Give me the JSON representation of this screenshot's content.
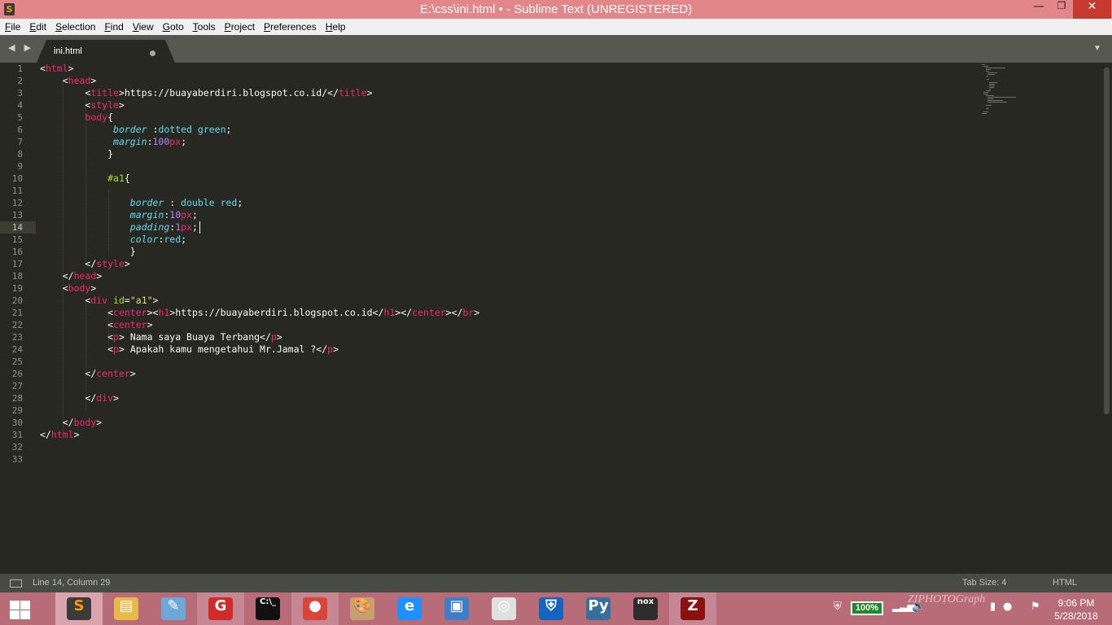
{
  "window": {
    "title": "E:\\css\\ini.html • - Sublime Text (UNREGISTERED)",
    "logo_letter": "S",
    "min_glyph": "—",
    "max_glyph": "❐",
    "close_glyph": "✕"
  },
  "menu": [
    "File",
    "Edit",
    "Selection",
    "Find",
    "View",
    "Goto",
    "Tools",
    "Project",
    "Preferences",
    "Help"
  ],
  "tabs": {
    "nav_arrows": "◀ ▶",
    "active_tab": "ini.html",
    "dropdown_glyph": "▼"
  },
  "editor": {
    "current_line": 14,
    "line_numbers": [
      "1",
      "2",
      "3",
      "4",
      "5",
      "6",
      "7",
      "8",
      "9",
      "10",
      "11",
      "12",
      "13",
      "14",
      "15",
      "16",
      "17",
      "18",
      "19",
      "20",
      "21",
      "22",
      "23",
      "24",
      "25",
      "26",
      "27",
      "28",
      "29",
      "30",
      "31",
      "32",
      "33"
    ]
  },
  "status": {
    "position": "Line 14, Column 29",
    "tab_size": "Tab Size: 4",
    "syntax": "HTML"
  },
  "taskbar": {
    "apps": [
      {
        "name": "sublime-text",
        "glyph": "S",
        "color": "#3b3b3b",
        "state": "active"
      },
      {
        "name": "file-explorer",
        "glyph": "▤",
        "color": "#e8b84a",
        "state": "normal"
      },
      {
        "name": "notepad",
        "glyph": "✎",
        "color": "#6ea8d8",
        "state": "normal"
      },
      {
        "name": "garena",
        "glyph": "G",
        "color": "#d12a2a",
        "state": "open"
      },
      {
        "name": "command-prompt",
        "glyph": "C:\\_",
        "color": "#111111",
        "state": "normal"
      },
      {
        "name": "chrome",
        "glyph": "●",
        "color": "#db4437",
        "state": "open"
      },
      {
        "name": "paint",
        "glyph": "🎨",
        "color": "#c8a070",
        "state": "normal"
      },
      {
        "name": "internet-explorer",
        "glyph": "e",
        "color": "#1e90ff",
        "state": "normal"
      },
      {
        "name": "remote-desktop",
        "glyph": "▣",
        "color": "#3d7ec9",
        "state": "normal"
      },
      {
        "name": "compass",
        "glyph": "◎",
        "color": "#e0e0e0",
        "state": "normal"
      },
      {
        "name": "windows-defender",
        "glyph": "⛨",
        "color": "#1565c0",
        "state": "normal"
      },
      {
        "name": "python",
        "glyph": "Py",
        "color": "#356e9f",
        "state": "normal"
      },
      {
        "name": "nox",
        "glyph": "nox",
        "color": "#2d2d2d",
        "state": "normal"
      },
      {
        "name": "game-z",
        "glyph": "Z",
        "color": "#8b1010",
        "state": "open"
      }
    ],
    "battery": "100%",
    "time": "9:06 PM",
    "date": "5/28/2018",
    "watermark": "ZIPHOTOGraph"
  }
}
